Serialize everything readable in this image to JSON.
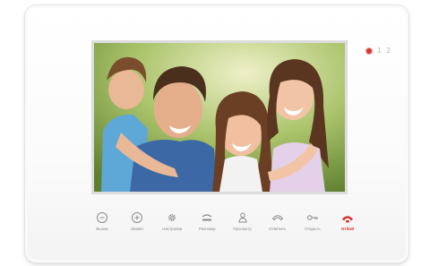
{
  "device": {
    "channels": [
      "1",
      "2"
    ],
    "accent_color": "#d62a2a",
    "button_color": "#8a8a8a"
  },
  "buttons": [
    {
      "label": "Вызов",
      "icon": "minus-circle-icon"
    },
    {
      "label": "Захват",
      "icon": "plus-circle-icon"
    },
    {
      "label": "Настройки",
      "icon": "gear-icon"
    },
    {
      "label": "Разговор",
      "icon": "handset-icon"
    },
    {
      "label": "Просмотр",
      "icon": "person-icon"
    },
    {
      "label": "Ответить",
      "icon": "phone-answer-icon"
    },
    {
      "label": "Открыть",
      "icon": "key-icon"
    },
    {
      "label": "Отбой",
      "icon": "phone-hangup-icon"
    }
  ]
}
